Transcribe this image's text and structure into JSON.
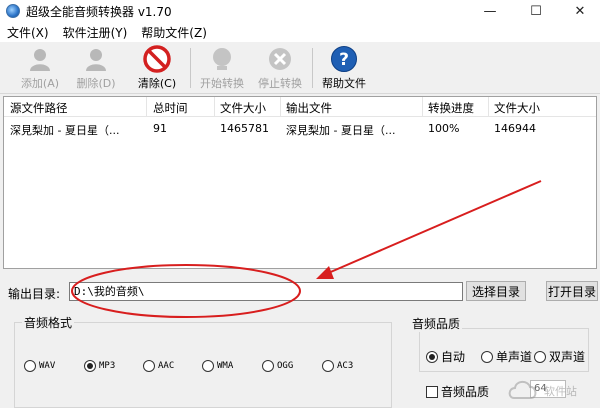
{
  "window": {
    "title": "超级全能音频转换器 v1.70",
    "controls": {
      "minimize": "—",
      "maximize": "☐",
      "close": "✕"
    }
  },
  "menu": [
    "文件(X)",
    "软件注册(Y)",
    "帮助文件(Z)"
  ],
  "toolbar": {
    "add": "添加(A)",
    "delete": "删除(D)",
    "clear": "清除(C)",
    "start": "开始转换",
    "stop": "停止转换",
    "help": "帮助文件"
  },
  "file_list": {
    "columns": [
      "源文件路径",
      "总时间",
      "文件大小",
      "输出文件",
      "转换进度",
      "文件大小"
    ],
    "rows": [
      [
        "深見梨加 - 夏日星（...",
        "91",
        "1465781",
        "深見梨加 - 夏日星（...",
        "100%",
        "146944"
      ]
    ]
  },
  "output": {
    "label": "输出目录:",
    "path": "D:\\我的音频\\",
    "choose_button": "选择目录",
    "open_button": "打开目录"
  },
  "format": {
    "title": "音频格式",
    "options": [
      "WAV",
      "MP3",
      "AAC",
      "WMA",
      "OGG",
      "AC3"
    ],
    "selected": "MP3"
  },
  "quality": {
    "title": "音频品质",
    "options": [
      "自动",
      "单声道",
      "双声道"
    ],
    "selected": "自动",
    "checkbox_label": "音频品质",
    "bitrate_value": "64"
  },
  "watermark": "软件站",
  "colors": {
    "annotation": "#d81e1e",
    "help_icon": "#1f5fb4",
    "clear_icon": "#d32020"
  }
}
